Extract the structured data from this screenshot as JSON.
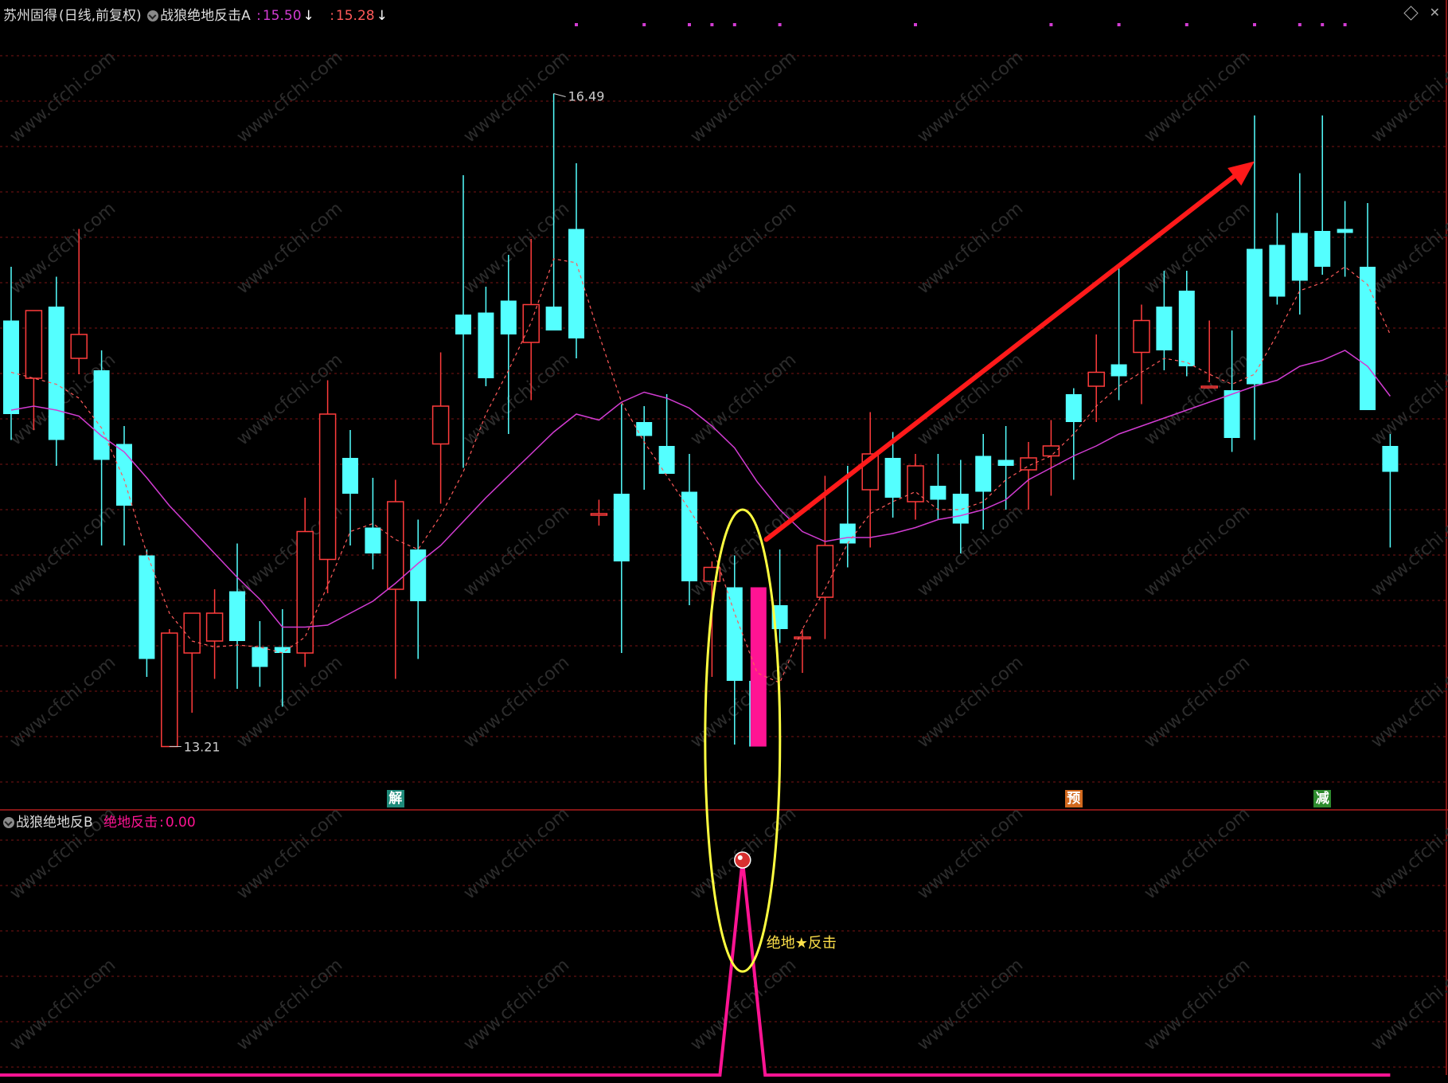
{
  "header": {
    "stock_name": "苏州固得",
    "period": "(日线,前复权)",
    "indicator_a": "战狼绝地反击A",
    "value_a1": "15.50",
    "value_a2": "15.28",
    "arrow_down": "↓",
    "sep1": ":",
    "sep2": ":"
  },
  "sub_header": {
    "indicator_b": "战狼绝地反B",
    "series_label": "绝地反击",
    "series_value": "0.00",
    "sep": ":"
  },
  "annotations": {
    "high_label": "16.49",
    "low_label": "13.21",
    "signal_label": "绝地★反击",
    "watermark": "www.cfchi.com"
  },
  "signals": [
    {
      "char": "解",
      "bg": "#1e8a7a",
      "index": 17
    },
    {
      "char": "预",
      "bg": "#d2691e",
      "index": 47
    },
    {
      "char": "减",
      "bg": "#2e8b2e",
      "index": 58
    }
  ],
  "colors": {
    "up": "#ff3c3c",
    "down": "#54ffff",
    "ma_solid": "#d23cd2",
    "ma_dashed": "#ff5a5a",
    "special_bar": "#ff1493",
    "highlight_ellipse": "#ffff40",
    "trend_arrow": "#ff1a1a",
    "grid": "#7a1414"
  },
  "chart_data": [
    {
      "type": "candlestick",
      "title": "战狼绝地反击A",
      "ylim": [
        13.0,
        16.8
      ],
      "ohlc": [
        [
          15.35,
          15.62,
          14.75,
          14.88
        ],
        [
          15.06,
          15.35,
          14.8,
          15.4
        ],
        [
          15.42,
          15.57,
          14.62,
          14.75
        ],
        [
          15.16,
          15.81,
          15.08,
          15.28
        ],
        [
          15.1,
          15.2,
          14.22,
          14.65
        ],
        [
          14.73,
          14.82,
          14.22,
          14.42
        ],
        [
          14.17,
          14.2,
          13.56,
          13.65
        ],
        [
          13.21,
          13.8,
          13.21,
          13.78
        ],
        [
          13.68,
          13.85,
          13.38,
          13.88
        ],
        [
          13.74,
          14.0,
          13.55,
          13.88
        ],
        [
          13.99,
          14.23,
          13.5,
          13.74
        ],
        [
          13.71,
          13.84,
          13.51,
          13.61
        ],
        [
          13.71,
          13.9,
          13.41,
          13.68
        ],
        [
          13.68,
          14.46,
          13.61,
          14.29
        ],
        [
          14.15,
          15.05,
          13.98,
          14.88
        ],
        [
          14.66,
          14.8,
          14.22,
          14.48
        ],
        [
          14.31,
          14.56,
          14.1,
          14.18
        ],
        [
          14.0,
          14.55,
          13.55,
          14.44
        ],
        [
          14.2,
          14.35,
          13.65,
          13.94
        ],
        [
          14.73,
          15.19,
          14.43,
          14.92
        ],
        [
          15.38,
          16.08,
          14.61,
          15.28
        ],
        [
          15.39,
          15.52,
          15.02,
          15.06
        ],
        [
          15.45,
          15.68,
          14.78,
          15.28
        ],
        [
          15.24,
          15.76,
          14.95,
          15.43
        ],
        [
          15.42,
          16.49,
          15.42,
          15.3
        ],
        [
          15.81,
          16.14,
          15.16,
          15.26
        ],
        [
          14.38,
          14.45,
          14.32,
          14.38
        ],
        [
          14.48,
          14.93,
          13.68,
          14.14
        ],
        [
          14.84,
          14.92,
          14.5,
          14.77
        ],
        [
          14.72,
          14.98,
          14.68,
          14.58
        ],
        [
          14.49,
          14.68,
          13.92,
          14.04
        ],
        [
          14.04,
          14.14,
          13.56,
          14.11
        ],
        [
          14.01,
          14.17,
          13.22,
          13.54
        ],
        [
          13.54,
          13.6,
          13.38,
          13.21
        ],
        [
          13.92,
          14.2,
          13.73,
          13.8
        ],
        [
          13.76,
          13.8,
          13.58,
          13.76
        ],
        [
          13.96,
          14.57,
          13.75,
          14.22
        ],
        [
          14.33,
          14.62,
          14.11,
          14.23
        ],
        [
          14.5,
          14.89,
          14.21,
          14.68
        ],
        [
          14.66,
          14.79,
          14.36,
          14.46
        ],
        [
          14.44,
          14.68,
          14.35,
          14.62
        ],
        [
          14.52,
          14.68,
          14.35,
          14.45
        ],
        [
          14.48,
          14.65,
          14.18,
          14.33
        ],
        [
          14.67,
          14.78,
          14.3,
          14.49
        ],
        [
          14.65,
          14.82,
          14.4,
          14.62
        ],
        [
          14.6,
          14.74,
          14.4,
          14.66
        ],
        [
          14.67,
          14.85,
          14.47,
          14.72
        ],
        [
          14.98,
          15.01,
          14.55,
          14.84
        ],
        [
          15.02,
          15.28,
          14.84,
          15.09
        ],
        [
          15.13,
          15.63,
          14.95,
          15.07
        ],
        [
          15.19,
          15.43,
          14.93,
          15.35
        ],
        [
          15.42,
          15.6,
          15.1,
          15.2
        ],
        [
          15.5,
          15.6,
          15.07,
          15.12
        ],
        [
          15.02,
          15.35,
          15.04,
          15.02
        ],
        [
          15.0,
          15.3,
          14.69,
          14.76
        ],
        [
          15.71,
          16.38,
          14.75,
          15.03
        ],
        [
          15.73,
          15.89,
          15.43,
          15.47
        ],
        [
          15.79,
          16.09,
          15.38,
          15.55
        ],
        [
          15.8,
          16.38,
          15.58,
          15.62
        ],
        [
          15.81,
          15.95,
          15.57,
          15.79
        ],
        [
          15.62,
          15.94,
          15.42,
          14.9
        ],
        [
          14.72,
          14.78,
          14.21,
          14.59
        ]
      ],
      "ma_solid": [
        14.9,
        14.92,
        14.9,
        14.87,
        14.77,
        14.69,
        14.56,
        14.42,
        14.3,
        14.18,
        14.06,
        13.95,
        13.81,
        13.81,
        13.82,
        13.88,
        13.94,
        14.03,
        14.13,
        14.22,
        14.34,
        14.46,
        14.57,
        14.68,
        14.79,
        14.88,
        14.85,
        14.94,
        14.99,
        14.96,
        14.91,
        14.82,
        14.71,
        14.54,
        14.4,
        14.29,
        14.24,
        14.26,
        14.26,
        14.28,
        14.31,
        14.35,
        14.37,
        14.4,
        14.45,
        14.55,
        14.61,
        14.67,
        14.72,
        14.78,
        14.82,
        14.86,
        14.9,
        14.94,
        14.98,
        15.02,
        15.05,
        15.12,
        15.15,
        15.2,
        15.12,
        14.97
      ],
      "ma_dashed": [
        15.09,
        15.06,
        15.03,
        14.96,
        14.81,
        14.55,
        14.18,
        13.88,
        13.74,
        13.71,
        13.72,
        13.71,
        13.68,
        13.76,
        14.02,
        14.29,
        14.33,
        14.25,
        14.2,
        14.37,
        14.59,
        14.88,
        15.1,
        15.34,
        15.66,
        15.64,
        15.28,
        14.94,
        14.74,
        14.57,
        14.4,
        14.22,
        13.88,
        13.58,
        13.53,
        13.8,
        14.0,
        14.23,
        14.38,
        14.44,
        14.49,
        14.4,
        14.4,
        14.44,
        14.55,
        14.62,
        14.67,
        14.78,
        14.92,
        15.02,
        15.09,
        15.16,
        15.14,
        15.08,
        15.03,
        15.08,
        15.28,
        15.5,
        15.54,
        15.62,
        15.53,
        15.28
      ],
      "special_bar": {
        "index": 32,
        "high": 14.01,
        "low": 13.21
      },
      "top_markers": [
        25,
        28,
        30,
        31,
        32,
        34,
        40,
        46,
        49,
        52,
        55,
        57,
        58,
        59
      ],
      "trend_arrow": {
        "from": [
          33.4,
          14.25
        ],
        "to": [
          55.0,
          16.15
        ]
      }
    },
    {
      "type": "line",
      "title": "战狼绝地反B",
      "series": [
        {
          "name": "绝地反击",
          "peak_index": 32,
          "values_note": "0 except peak 1"
        }
      ],
      "ylim": [
        0,
        1.0
      ]
    }
  ]
}
